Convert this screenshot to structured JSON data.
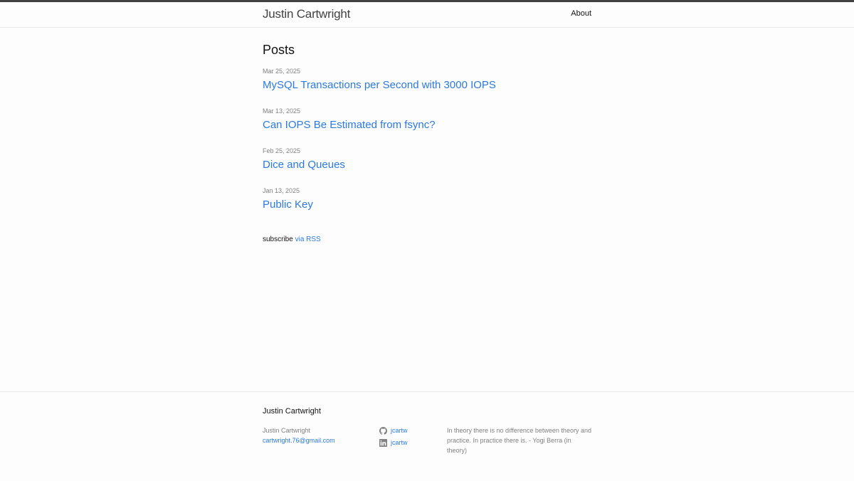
{
  "header": {
    "site_title": "Justin Cartwright",
    "nav": [
      {
        "label": "About"
      }
    ]
  },
  "main": {
    "heading": "Posts",
    "posts": [
      {
        "date": "Mar 25, 2025",
        "title": "MySQL Transactions per Second with 3000 IOPS"
      },
      {
        "date": "Mar 13, 2025",
        "title": "Can IOPS Be Estimated from fsync?"
      },
      {
        "date": "Feb 25, 2025",
        "title": "Dice and Queues"
      },
      {
        "date": "Jan 13, 2025",
        "title": "Public Key"
      }
    ],
    "rss": {
      "prefix": "subscribe",
      "link_label": "via RSS"
    }
  },
  "footer": {
    "heading": "Justin Cartwright",
    "name": "Justin Cartwright",
    "email": "cartwright.76@gmail.com",
    "social": [
      {
        "icon": "github-icon",
        "label": "jcartw"
      },
      {
        "icon": "linkedin-icon",
        "label": "jcartw"
      }
    ],
    "quote": "In theory there is no difference between theory and practice. In practice there is. - Yogi Berra (in theory)"
  },
  "colors": {
    "link": "#2a7ae2",
    "meta": "#828282",
    "top_bar": "#424242"
  }
}
